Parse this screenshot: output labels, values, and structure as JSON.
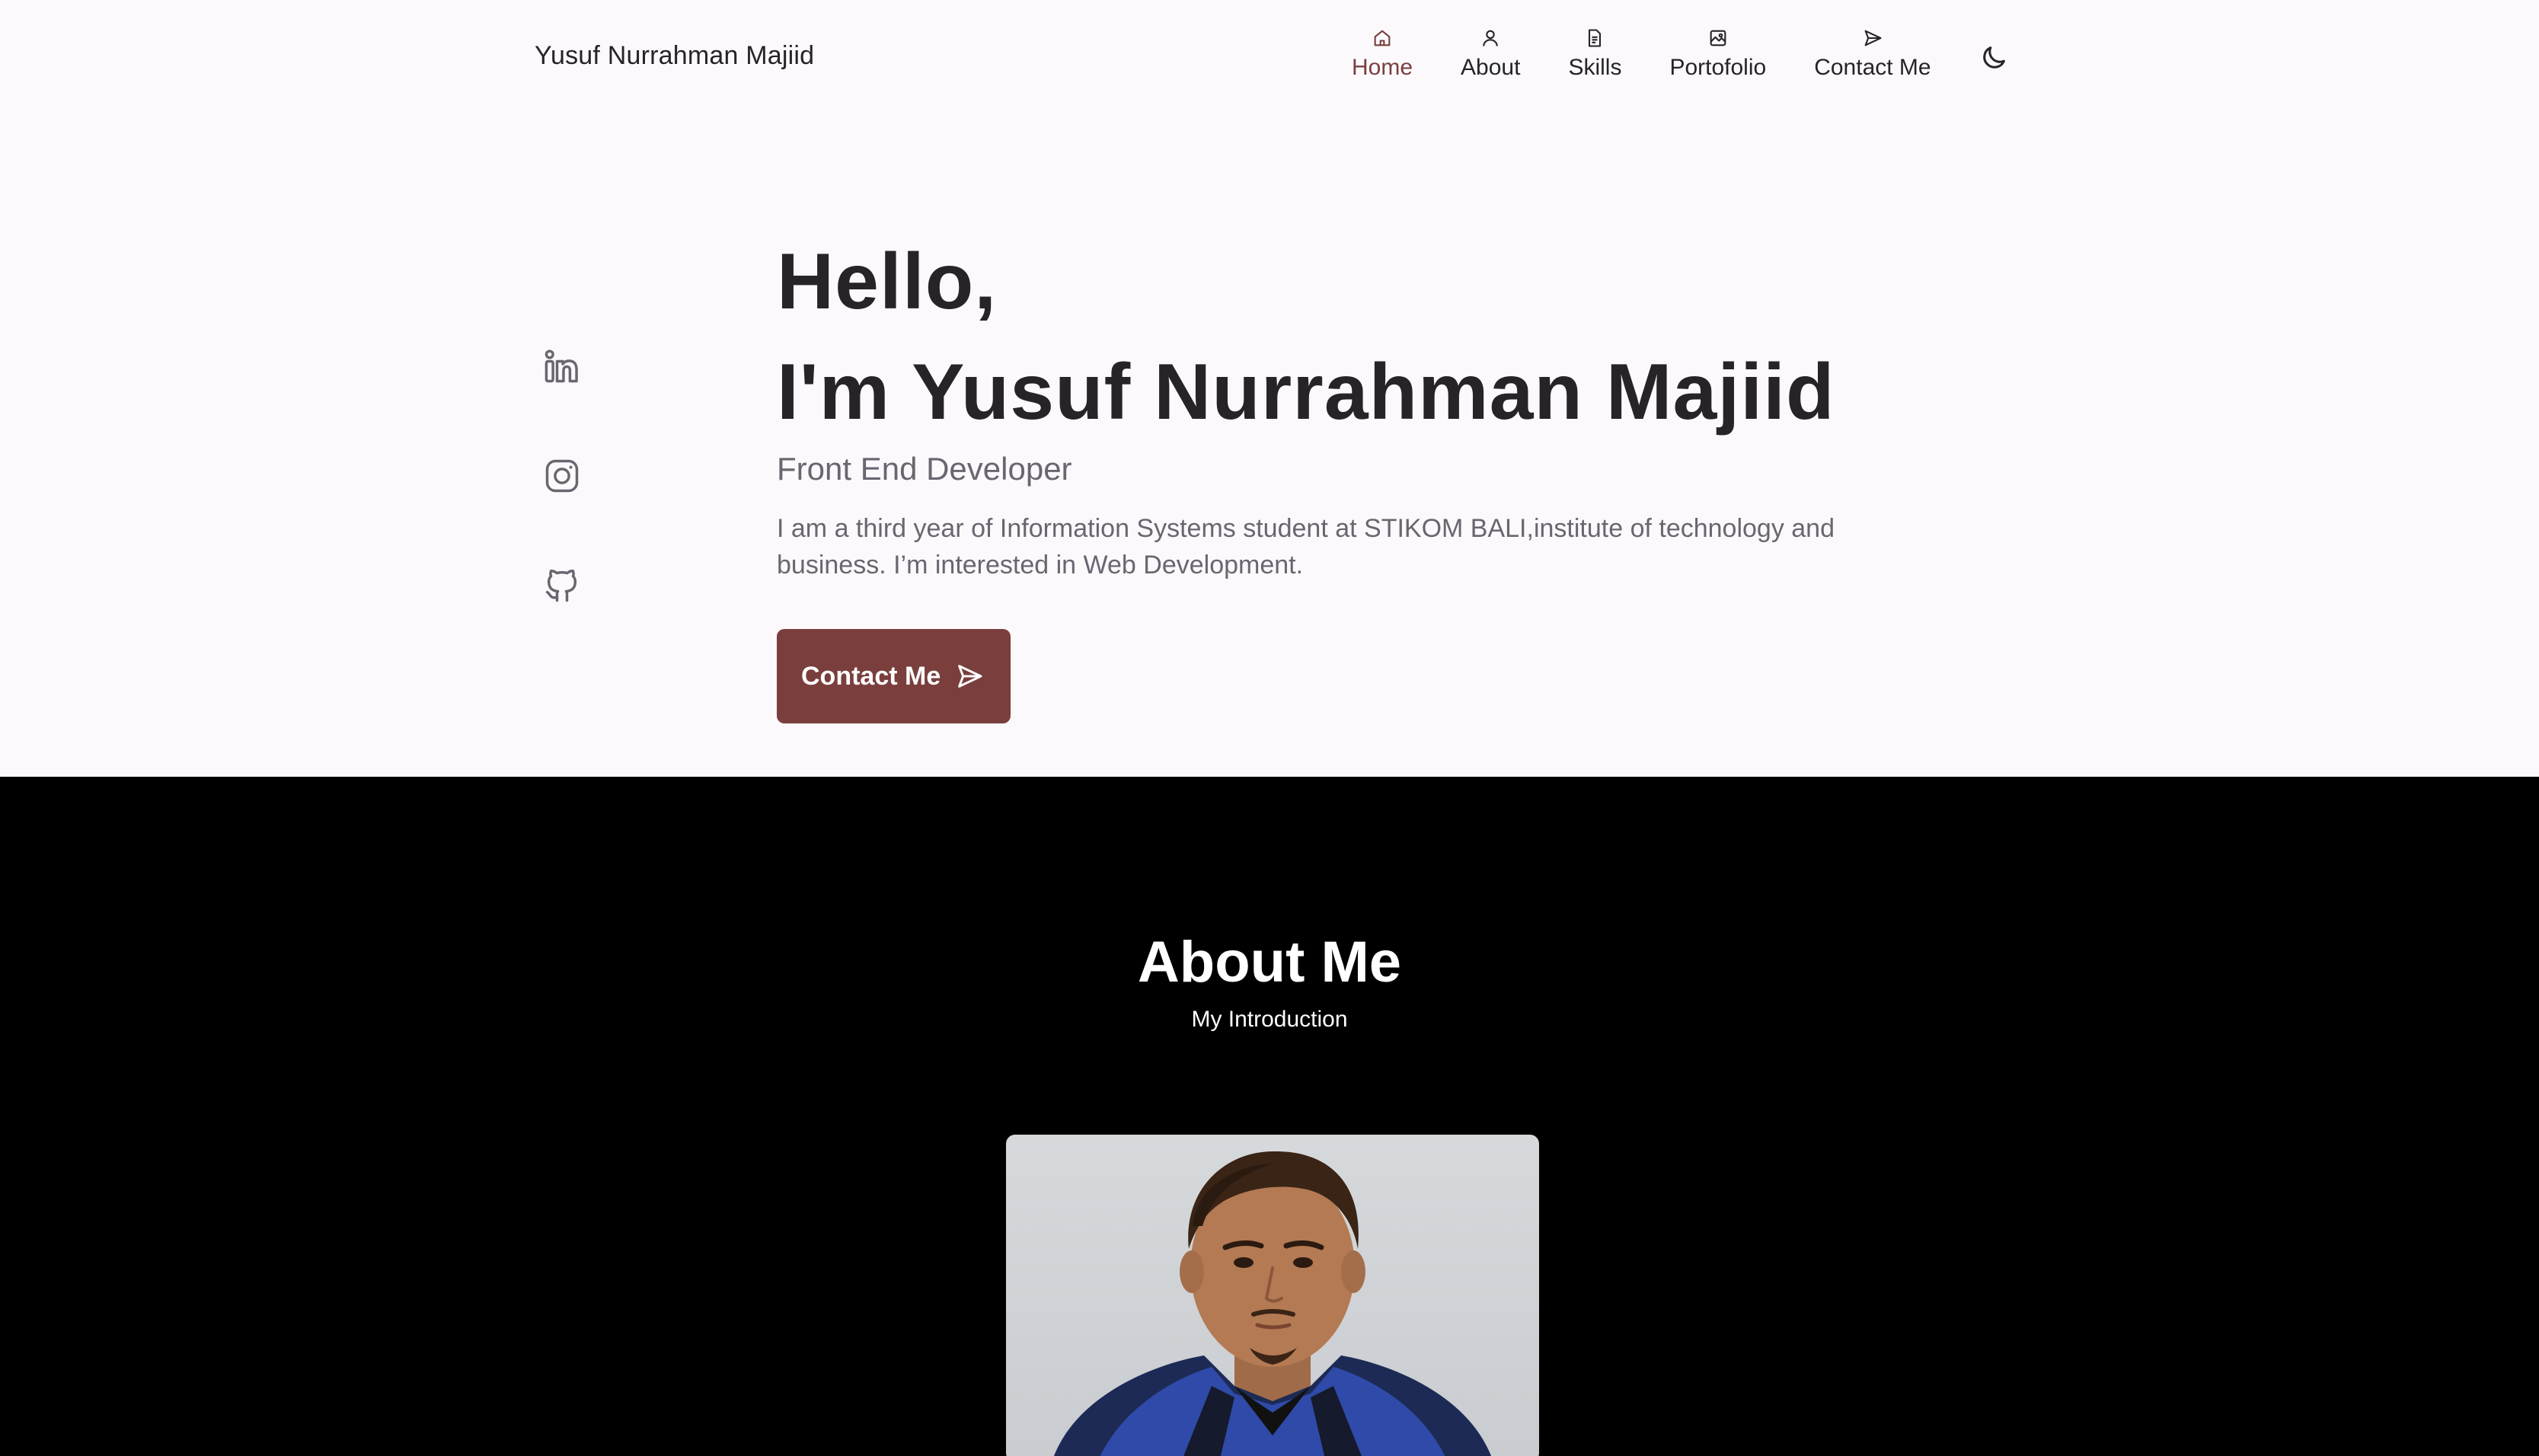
{
  "brand": {
    "name": "Yusuf Nurrahman Majiid"
  },
  "nav": {
    "items": [
      {
        "label": "Home",
        "icon": "home-icon",
        "active": true
      },
      {
        "label": "About",
        "icon": "user-icon",
        "active": false
      },
      {
        "label": "Skills",
        "icon": "file-icon",
        "active": false
      },
      {
        "label": "Portofolio",
        "icon": "image-icon",
        "active": false
      },
      {
        "label": "Contact Me",
        "icon": "send-icon",
        "active": false
      }
    ],
    "theme_toggle_icon": "moon-icon"
  },
  "socials": [
    {
      "name": "linkedin-icon"
    },
    {
      "name": "instagram-icon"
    },
    {
      "name": "github-icon"
    }
  ],
  "hero": {
    "greeting": "Hello,",
    "name": "I'm Yusuf Nurrahman Majiid",
    "role": "Front End Developer",
    "description": "I am a third year of Information Systems student at STIKOM BALI,institute of technology and business. I’m interested in Web Development.",
    "cta_label": "Contact Me",
    "cta_icon": "send-icon"
  },
  "about": {
    "title": "About Me",
    "subtitle": "My Introduction",
    "photo": "profile-photo"
  },
  "colors": {
    "accent": "#7a3f3d",
    "text": "#262429",
    "muted": "#6b6570",
    "background": "#fbf9fc",
    "about_background": "#000000"
  }
}
